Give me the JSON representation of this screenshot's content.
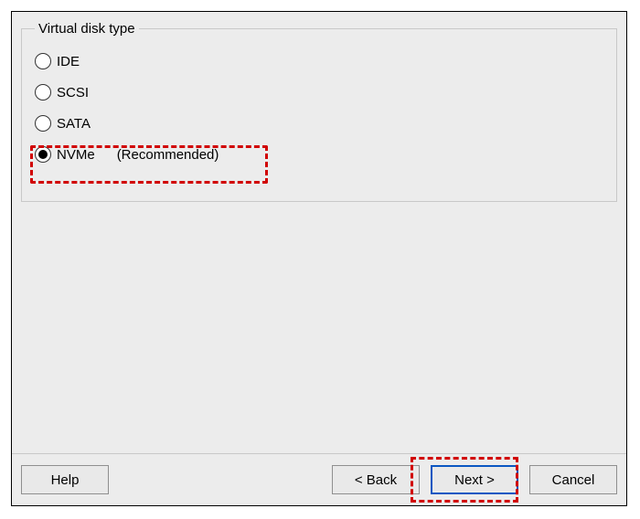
{
  "group": {
    "legend": "Virtual disk type",
    "options": [
      {
        "label": "IDE",
        "checked": false
      },
      {
        "label": "SCSI",
        "checked": false
      },
      {
        "label": "SATA",
        "checked": false
      },
      {
        "label": "NVMe",
        "checked": true,
        "suffix": "(Recommended)"
      }
    ]
  },
  "buttons": {
    "help": "Help",
    "back": "< Back",
    "next": "Next >",
    "cancel": "Cancel"
  }
}
